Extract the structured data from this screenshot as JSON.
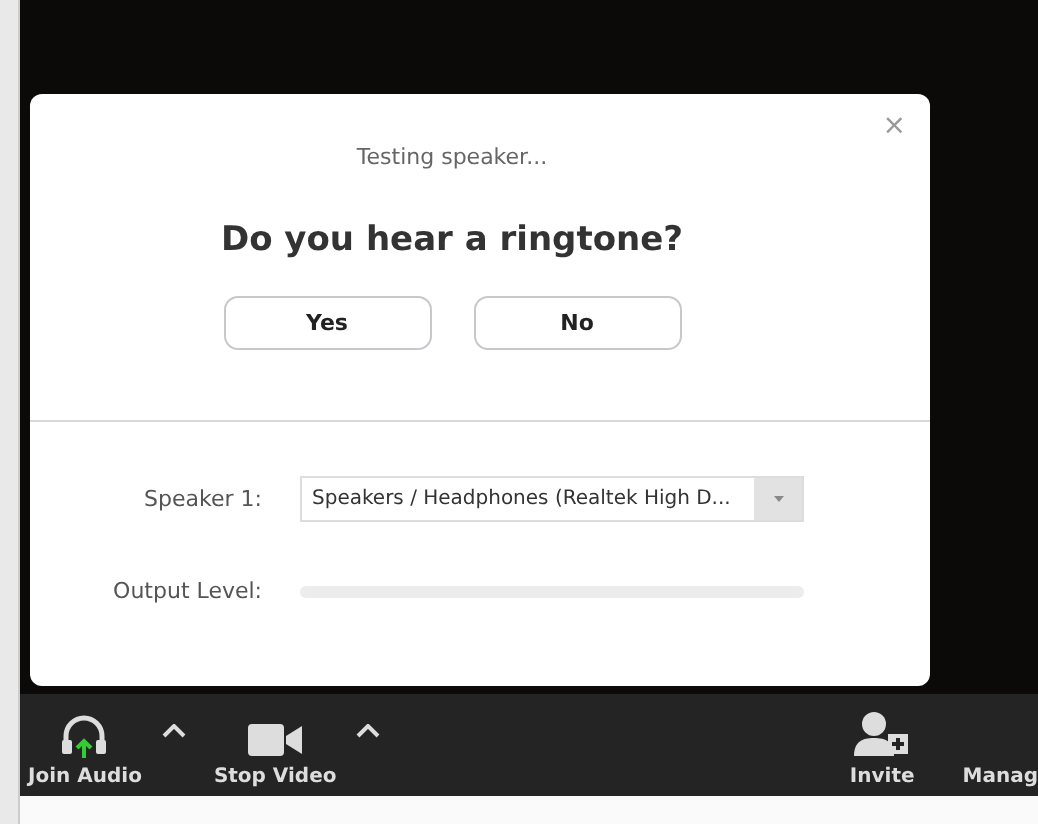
{
  "dialog": {
    "status": "Testing speaker...",
    "question": "Do you hear a ringtone?",
    "close": "×",
    "buttons": [
      "Yes",
      "No"
    ],
    "speaker": {
      "label": "Speaker 1:",
      "value": "Speakers / Headphones (Realtek High D..."
    },
    "output": {
      "label": "Output Level:",
      "level": 0
    }
  },
  "toolbar": [
    {
      "kind": "audio",
      "label": "Join Audio",
      "caret": true
    },
    {
      "kind": "video",
      "label": "Stop Video",
      "caret": true
    },
    {
      "kind": "invite",
      "label": "Invite",
      "caret": false
    },
    {
      "kind": "manage",
      "label": "Manag",
      "caret": false
    }
  ]
}
